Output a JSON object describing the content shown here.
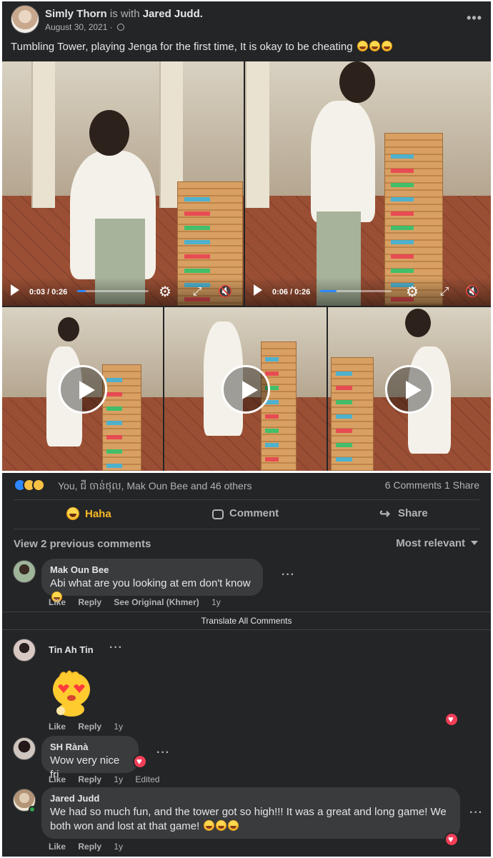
{
  "post": {
    "author": "Simly Thorn",
    "with_text": "is with",
    "tagged": "Jared Judd.",
    "date": "August 30, 2021",
    "date_sep": "·",
    "text": "Tumbling Tower, playing Jenga for the first time, It is okay to be cheating",
    "more": "•••"
  },
  "videos": [
    {
      "time": "0:03 / 0:26",
      "progress": 0.115
    },
    {
      "time": "0:06 / 0:26",
      "progress": 0.23
    }
  ],
  "reactions": {
    "names": "You, ជី ចាន់ថុល, Mak Oun Bee and 46 others",
    "counts": "6 Comments  1 Share",
    "types": [
      "like-icon",
      "haha-icon",
      "wow-icon"
    ]
  },
  "actions": {
    "haha": "Haha",
    "comment": "Comment",
    "share": "Share",
    "active_color": "#f7b928"
  },
  "comments_header": {
    "view_previous": "View 2 previous comments",
    "sort": "Most relevant"
  },
  "translate_all": "Translate All Comments",
  "comments": [
    {
      "name": "Mak Oun Bee",
      "text": "Abi what are you looking at em don't know",
      "like": "Like",
      "reply": "Reply",
      "extra": "See Original (Khmer)",
      "time": "1y"
    },
    {
      "name": "Tin Ah Tin",
      "text": "",
      "like": "Like",
      "reply": "Reply",
      "time": "1y"
    },
    {
      "name": "SH Rànà",
      "text": "Wow very nice fri",
      "like": "Like",
      "reply": "Reply",
      "time": "1y",
      "extra": "Edited"
    },
    {
      "name": "Jared Judd",
      "text": "We had so much fun, and the tower got so high!!! It was a great and long game! We both won and lost at that game!",
      "like": "Like",
      "reply": "Reply",
      "time": "1y"
    }
  ],
  "colors": {
    "card_bg": "#242526",
    "bubble_bg": "#3a3b3c",
    "text": "#e4e6eb",
    "muted": "#b0b3b8",
    "love": "#f33e58",
    "like_blue": "#2d88ff"
  }
}
